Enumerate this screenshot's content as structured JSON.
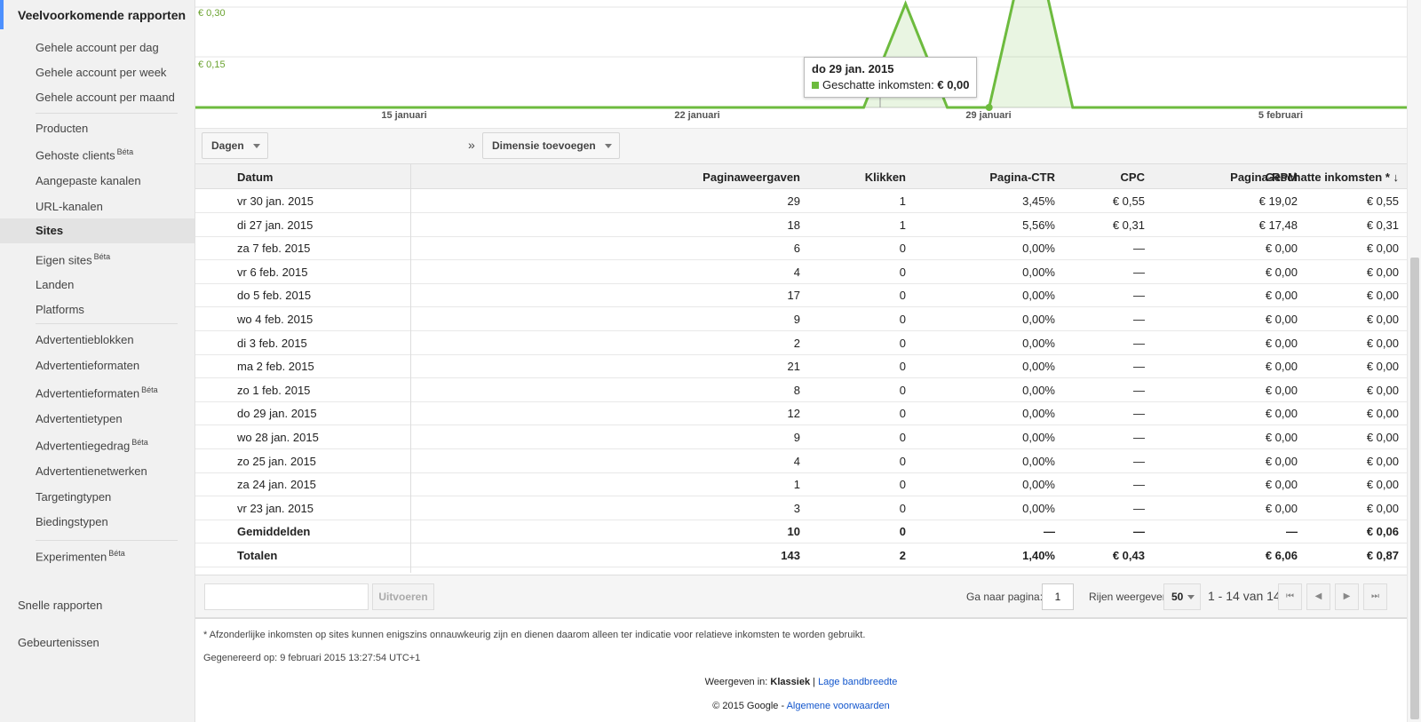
{
  "sidebar": {
    "section_title": "Veelvoorkomende rapporten",
    "items": [
      {
        "label": "Gehele account per dag",
        "beta": ""
      },
      {
        "label": "Gehele account per week",
        "beta": ""
      },
      {
        "label": "Gehele account per maand",
        "beta": ""
      },
      {
        "label": "Producten",
        "beta": ""
      },
      {
        "label": "Gehoste clients",
        "beta": "Béta"
      },
      {
        "label": "Aangepaste kanalen",
        "beta": ""
      },
      {
        "label": "URL-kanalen",
        "beta": ""
      },
      {
        "label": "Sites",
        "beta": ""
      },
      {
        "label": "Eigen sites",
        "beta": "Béta"
      },
      {
        "label": "Landen",
        "beta": ""
      },
      {
        "label": "Platforms",
        "beta": ""
      },
      {
        "label": "Advertentieblokken",
        "beta": ""
      },
      {
        "label": "Advertentieformaten",
        "beta": ""
      },
      {
        "label": "Advertentieformaten",
        "beta": "Béta"
      },
      {
        "label": "Advertentietypen",
        "beta": ""
      },
      {
        "label": "Advertentiegedrag",
        "beta": "Béta"
      },
      {
        "label": "Advertentienetwerken",
        "beta": ""
      },
      {
        "label": "Targetingtypen",
        "beta": ""
      },
      {
        "label": "Biedingstypen",
        "beta": ""
      },
      {
        "label": "Experimenten",
        "beta": "Béta"
      }
    ],
    "quick_reports": "Snelle rapporten",
    "events": "Gebeurtenissen"
  },
  "chart": {
    "y_labels": [
      "€ 0,30",
      "€ 0,15"
    ],
    "x_labels": [
      "15 januari",
      "22 januari",
      "29 januari",
      "5 februari"
    ],
    "tooltip_title": "do 29 jan. 2015",
    "tooltip_series": "Geschatte inkomsten:",
    "tooltip_value": "€ 0,00",
    "series_color": "#6dbb3e"
  },
  "chart_data": {
    "type": "area",
    "x": [
      "2015-01-23",
      "2015-01-24",
      "2015-01-25",
      "2015-01-26",
      "2015-01-27",
      "2015-01-28",
      "2015-01-29",
      "2015-01-30",
      "2015-01-31",
      "2015-02-01",
      "2015-02-02",
      "2015-02-03",
      "2015-02-04",
      "2015-02-05",
      "2015-02-06",
      "2015-02-07"
    ],
    "series": [
      {
        "name": "Geschatte inkomsten",
        "values": [
          0,
          0,
          0,
          0,
          0.31,
          0,
          0,
          0.55,
          0,
          0,
          0,
          0,
          0,
          0,
          0,
          0
        ]
      }
    ],
    "ylim": [
      0,
      0.35
    ],
    "grid": true
  },
  "toolbar": {
    "days_label": "Dagen",
    "raquo": "»",
    "add_dimension_label": "Dimensie toevoegen"
  },
  "table": {
    "headers": [
      "Datum",
      "Paginaweergaven",
      "Klikken",
      "Pagina-CTR",
      "CPC",
      "Pagina-RPM",
      "Geschatte inkomsten * ↓"
    ],
    "rows": [
      [
        "vr 30 jan. 2015",
        "29",
        "1",
        "3,45%",
        "€ 0,55",
        "€ 19,02",
        "€ 0,55"
      ],
      [
        "di 27 jan. 2015",
        "18",
        "1",
        "5,56%",
        "€ 0,31",
        "€ 17,48",
        "€ 0,31"
      ],
      [
        "za 7 feb. 2015",
        "6",
        "0",
        "0,00%",
        "—",
        "€ 0,00",
        "€ 0,00"
      ],
      [
        "vr 6 feb. 2015",
        "4",
        "0",
        "0,00%",
        "—",
        "€ 0,00",
        "€ 0,00"
      ],
      [
        "do 5 feb. 2015",
        "17",
        "0",
        "0,00%",
        "—",
        "€ 0,00",
        "€ 0,00"
      ],
      [
        "wo 4 feb. 2015",
        "9",
        "0",
        "0,00%",
        "—",
        "€ 0,00",
        "€ 0,00"
      ],
      [
        "di 3 feb. 2015",
        "2",
        "0",
        "0,00%",
        "—",
        "€ 0,00",
        "€ 0,00"
      ],
      [
        "ma 2 feb. 2015",
        "21",
        "0",
        "0,00%",
        "—",
        "€ 0,00",
        "€ 0,00"
      ],
      [
        "zo 1 feb. 2015",
        "8",
        "0",
        "0,00%",
        "—",
        "€ 0,00",
        "€ 0,00"
      ],
      [
        "do 29 jan. 2015",
        "12",
        "0",
        "0,00%",
        "—",
        "€ 0,00",
        "€ 0,00"
      ],
      [
        "wo 28 jan. 2015",
        "9",
        "0",
        "0,00%",
        "—",
        "€ 0,00",
        "€ 0,00"
      ],
      [
        "zo 25 jan. 2015",
        "4",
        "0",
        "0,00%",
        "—",
        "€ 0,00",
        "€ 0,00"
      ],
      [
        "za 24 jan. 2015",
        "1",
        "0",
        "0,00%",
        "—",
        "€ 0,00",
        "€ 0,00"
      ],
      [
        "vr 23 jan. 2015",
        "3",
        "0",
        "0,00%",
        "—",
        "€ 0,00",
        "€ 0,00"
      ]
    ],
    "averages": [
      "Gemiddelden",
      "10",
      "0",
      "—",
      "—",
      "—",
      "€ 0,06"
    ],
    "totals": [
      "Totalen",
      "143",
      "2",
      "1,40%",
      "€ 0,43",
      "€ 6,06",
      "€ 0,87"
    ]
  },
  "pager": {
    "apply_label": "Uitvoeren",
    "goto_label": "Ga naar pagina:",
    "goto_value": "1",
    "rows_label": "Rijen weergeven:",
    "rows_value": "50",
    "range": "1 - 14 van 14",
    "first": "⏮",
    "prev": "◀",
    "next": "▶",
    "last": "⏭"
  },
  "footer": {
    "note": "* Afzonderlijke inkomsten op sites kunnen enigszins onnauwkeurig zijn en dienen daarom alleen ter indicatie voor relatieve inkomsten te worden gebruikt.",
    "generated": "Gegenereerd op: 9 februari 2015 13:27:54 UTC+1",
    "view_in": "Weergeven in:",
    "classic": "Klassiek",
    "separator": "|",
    "low_bandwidth": "Lage bandbreedte",
    "copyright": "© 2015 Google -",
    "terms": "Algemene voorwaarden"
  }
}
